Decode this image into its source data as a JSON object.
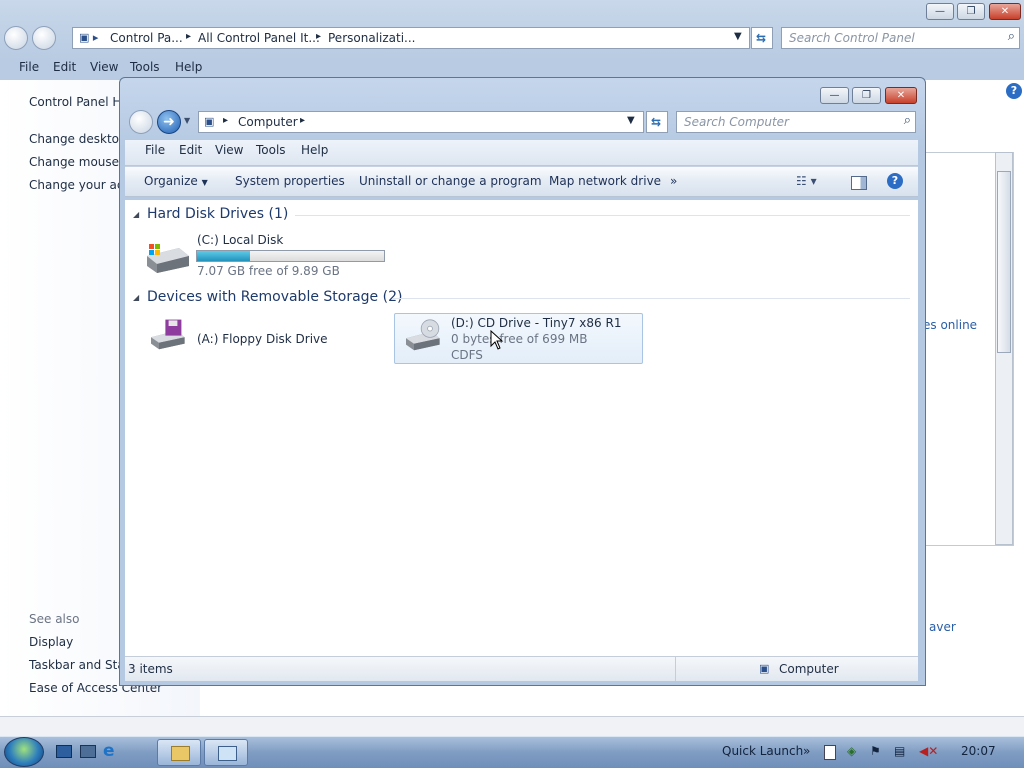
{
  "background_window": {
    "breadcrumbs": [
      "Control Pa...",
      "All Control Panel It...",
      "Personalizati..."
    ],
    "search_placeholder": "Search Control Panel",
    "menu": [
      "File",
      "Edit",
      "View",
      "Tools",
      "Help"
    ],
    "sidebar": {
      "home": "Control Panel Ho",
      "links": [
        "Change desktop",
        "Change mouse p",
        "Change your acc"
      ],
      "see_also_heading": "See also",
      "see_also": [
        "Display",
        "Taskbar and Start",
        "Ease of Access Center"
      ]
    },
    "right_fragments": [
      "es online",
      "aver"
    ]
  },
  "window": {
    "address": "Computer",
    "search_placeholder": "Search Computer",
    "menu": [
      "File",
      "Edit",
      "View",
      "Tools",
      "Help"
    ],
    "commands": {
      "organize": "Organize",
      "system_properties": "System properties",
      "uninstall": "Uninstall or change a program",
      "map_drive": "Map network drive",
      "more": "»"
    },
    "groups": [
      {
        "title": "Hard Disk Drives (1)",
        "drives": [
          {
            "name": "(C:) Local Disk",
            "free_text": "7.07 GB free of 9.89 GB",
            "used_fraction": 0.285
          }
        ]
      },
      {
        "title": "Devices with Removable Storage (2)",
        "drives": [
          {
            "name": "(A:) Floppy Disk Drive"
          },
          {
            "name": "(D:) CD Drive - Tiny7 x86 R1",
            "free_text": "0 bytes free of 699 MB",
            "fs": "CDFS"
          }
        ]
      }
    ],
    "status": {
      "items": "3 items",
      "location": "Computer"
    }
  },
  "taskbar": {
    "quick_launch": "Quick Launch",
    "clock": "20:07"
  },
  "colors": {
    "accent": "#2393bd",
    "title_bar": "#b5c9e2",
    "close": "#c7402b"
  }
}
